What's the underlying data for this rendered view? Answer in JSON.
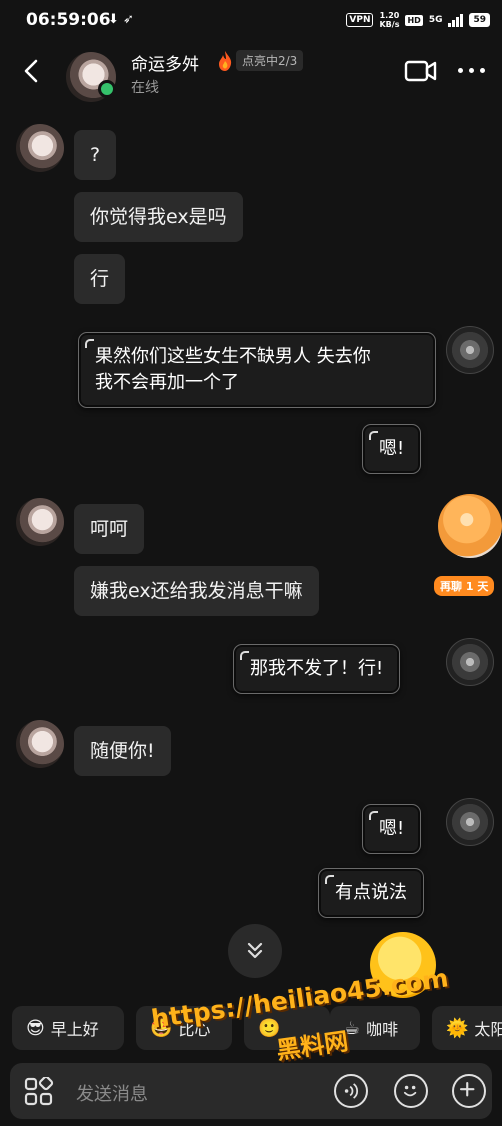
{
  "status_bar": {
    "time": "06:59:06",
    "vpn": "VPN",
    "speed_value": "1.20",
    "speed_unit": "KB/s",
    "hd": "HD",
    "network": "5G",
    "battery": "59"
  },
  "header": {
    "contact_name": "命运多舛",
    "lit_badge": "点亮中2/3",
    "presence": "在线"
  },
  "messages": [
    {
      "from": "contact",
      "text": "?"
    },
    {
      "from": "contact",
      "text": "你觉得我ex是吗"
    },
    {
      "from": "contact",
      "text": "行"
    },
    {
      "from": "me",
      "line1": "果然你们这些女生不缺男人 失去你",
      "line2": "我不会再加一个了"
    },
    {
      "from": "me",
      "text": "嗯!"
    },
    {
      "from": "contact",
      "text": "呵呵"
    },
    {
      "from": "contact",
      "text": "嫌我ex还给我发消息干嘛"
    },
    {
      "from": "me",
      "text": "那我不发了！行!"
    },
    {
      "from": "contact",
      "text": "随便你!"
    },
    {
      "from": "me",
      "text": "嗯!"
    },
    {
      "from": "me",
      "text": "有点说法"
    }
  ],
  "streak_badge": "再聊 1 天",
  "quick_replies": [
    {
      "emoji": "😎",
      "label": "早上好"
    },
    {
      "emoji": "🤩",
      "label": "比心"
    },
    {
      "emoji": "🙂",
      "label": ""
    },
    {
      "emoji": "☕",
      "label": "咖啡"
    },
    {
      "emoji": "🌞",
      "label": "太阳"
    }
  ],
  "watermark": {
    "url": "https://heiliao45.com",
    "name": "黑料网"
  },
  "input": {
    "placeholder": "发送消息"
  },
  "colors": {
    "background": "#131313",
    "bubble_in": "#2b2b2b",
    "online": "#35c26b",
    "streak": "#ff8a1f",
    "watermark": "#ffb21a"
  }
}
